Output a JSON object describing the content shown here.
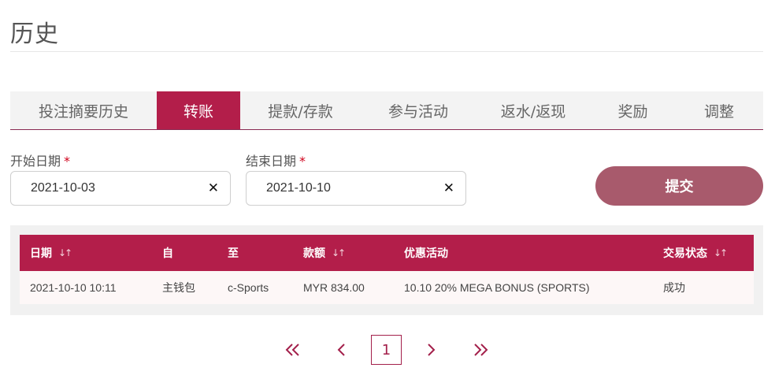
{
  "page": {
    "title": "历史"
  },
  "tabs": [
    {
      "label": "投注摘要历史",
      "active": false
    },
    {
      "label": "转账",
      "active": true
    },
    {
      "label": "提款/存款",
      "active": false
    },
    {
      "label": "参与活动",
      "active": false
    },
    {
      "label": "返水/返现",
      "active": false
    },
    {
      "label": "奖励",
      "active": false
    },
    {
      "label": "调整",
      "active": false
    }
  ],
  "filters": {
    "start_label": "开始日期",
    "end_label": "结束日期",
    "required_mark": "*",
    "start_value": "2021-10-03",
    "end_value": "2021-10-10",
    "clear_glyph": "✕",
    "submit_label": "提交"
  },
  "table": {
    "headers": [
      "日期",
      "自",
      "至",
      "款额",
      "优惠活动",
      "交易状态"
    ],
    "sort_glyph": "↓↑",
    "rows": [
      [
        "2021-10-10 10:11",
        "主钱包",
        "c-Sports",
        "MYR 834.00",
        "10.10 20% MEGA BONUS (SPORTS)",
        "成功"
      ]
    ]
  },
  "pagination": {
    "current_page": "1"
  },
  "colors": {
    "accent": "#b31e4a",
    "submit": "#a85a6c",
    "pager": "#a3204b"
  },
  "icons": {
    "clear": "close-icon",
    "sort": "sort-icon",
    "first": "double-chevron-left-icon",
    "prev": "chevron-left-icon",
    "next": "chevron-right-icon",
    "last": "double-chevron-right-icon"
  }
}
